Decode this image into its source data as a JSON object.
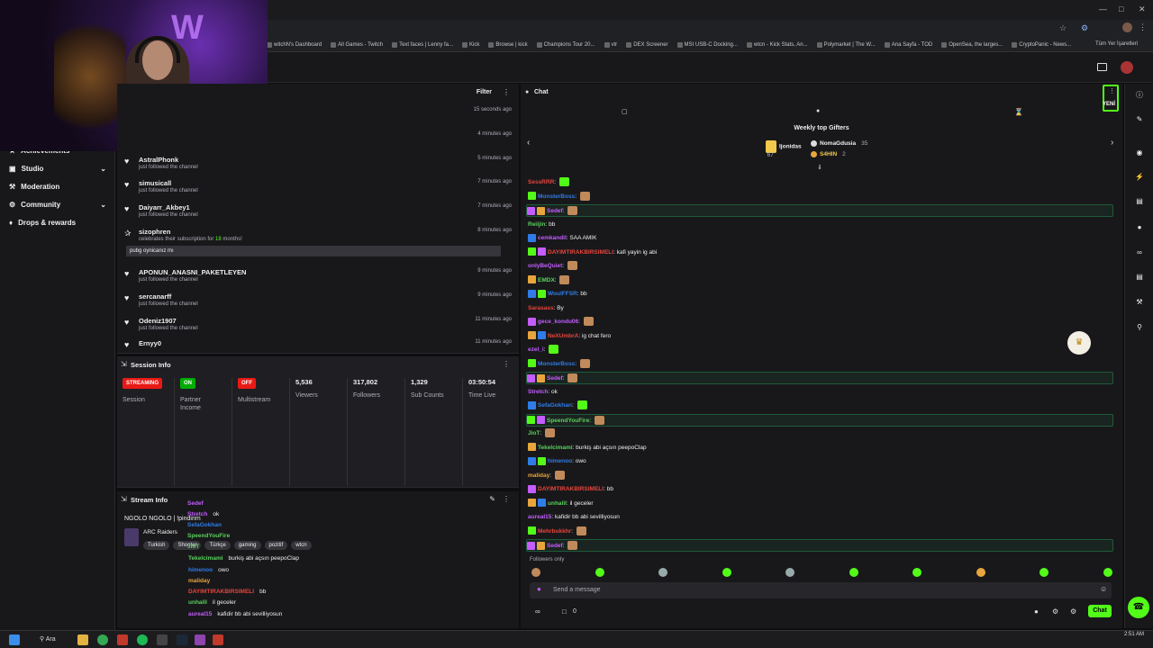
{
  "browser": {
    "bookmarks": [
      "witchN's Dashboard",
      "All Games - Twitch",
      "Text faces | Lenny fa...",
      "Kick",
      "Browse | kick",
      "Champions Tour 20...",
      "vtr",
      "DEX Screener",
      "MSI USB-C Docking...",
      "wtcn - Kick Stats, An...",
      "Polymarket | The W...",
      "Ana Sayfa - TOD",
      "OpenSea, the larges...",
      "CryptoPanic - News..."
    ],
    "bookmarks_folder": "Tüm Yer İşaretleri"
  },
  "nav": {
    "items": [
      {
        "label": "Achievements"
      },
      {
        "label": "Studio"
      },
      {
        "label": "Moderation"
      },
      {
        "label": "Community"
      },
      {
        "label": "Drops & rewards"
      }
    ]
  },
  "activity": {
    "filter_label": "Filter",
    "rows": [
      {
        "user": "",
        "sub": "",
        "time": "15 seconds ago"
      },
      {
        "user": "",
        "sub": "",
        "time": "4 minutes ago"
      },
      {
        "user": "AstralPhonk",
        "sub": "just followed the channel",
        "time": "5 minutes ago"
      },
      {
        "user": "simusicall",
        "sub": "just followed the channel",
        "time": "7 minutes ago"
      },
      {
        "user": "Daiyarr_Akbey1",
        "sub": "just followed the channel",
        "time": "7 minutes ago"
      },
      {
        "user": "sizophren",
        "sub_prefix": "celebrates their subscription for ",
        "sub_months": "18",
        "sub_suffix": " months!",
        "message": "pubg oynicanız mı",
        "time": "8 minutes ago"
      },
      {
        "user": "APONUN_ANASNI_PAKETLEYEN",
        "sub": "just followed the channel",
        "time": "9 minutes ago"
      },
      {
        "user": "sercanarff",
        "sub": "just followed the channel",
        "time": "9 minutes ago"
      },
      {
        "user": "Odeniz1907",
        "sub": "just followed the channel",
        "time": "11 minutes ago"
      },
      {
        "user": "Ernyy0",
        "sub": "",
        "time": "11 minutes ago"
      }
    ]
  },
  "session": {
    "title": "Session Info",
    "streaming": {
      "pill": "STREAMING",
      "label": "Session"
    },
    "partner": {
      "pill": "ON",
      "label": "Partner Income"
    },
    "multistream": {
      "pill": "OFF",
      "label": "Multistream"
    },
    "viewers": {
      "value": "5,536",
      "label": "Viewers"
    },
    "followers": {
      "value": "317,802",
      "label": "Followers"
    },
    "subs": {
      "value": "1,329",
      "label": "Sub Counts"
    },
    "time": {
      "value": "03:50:54",
      "label": "Time Live"
    }
  },
  "stream_info": {
    "title": "Stream Info",
    "stream_title": "NGOLO NGOLO | !pindirim",
    "category": "ARC Raiders",
    "tags": [
      "Turkish",
      "Shooter",
      "Türkçe",
      "gaming",
      "pozitif",
      "wtcn"
    ],
    "overlay": [
      {
        "user": "Sedef",
        "text": ""
      },
      {
        "user": "Stretch",
        "text": "ok"
      },
      {
        "user": "SefaGokhan",
        "text": ""
      },
      {
        "user": "SpeendYouFire",
        "text": ""
      },
      {
        "user": "JioT",
        "text": ""
      },
      {
        "user": "Tekelcimami",
        "text": "burkiş abi açsın peepoClap"
      },
      {
        "user": "himenoo",
        "text": "owo"
      },
      {
        "user": "maliday",
        "text": ""
      },
      {
        "user": "DAYIMTIRAKBIRSIMELI",
        "text": "bb"
      },
      {
        "user": "unhalil",
        "text": "il geceler"
      },
      {
        "user": "aureal15",
        "text": "kafidir bb abi sevilliyosun"
      }
    ]
  },
  "chat": {
    "title": "Chat",
    "new_label": "YENİ",
    "gifters_title": "Weekly top Gifters",
    "gifters": [
      {
        "name": "ljonidas",
        "count": "67"
      },
      {
        "name": "NomaGdusia",
        "count": "35"
      },
      {
        "name": "S4HIN",
        "count": "2"
      }
    ],
    "followers_only": "Followers only",
    "input_placeholder": "Send a message",
    "viewer_count": "0",
    "chat_button": "Chat",
    "messages": [
      {
        "user": "SessRRR",
        "color": "#e8453c",
        "text": "",
        "hl": false
      },
      {
        "user": "MonsterBoss",
        "color": "#2f7ce8",
        "text": "",
        "hl": false
      },
      {
        "user": "Sedef",
        "color": "#c45cff",
        "text": "",
        "hl": true
      },
      {
        "user": "Reiijin",
        "color": "#5ad25a",
        "text": "bb",
        "hl": false
      },
      {
        "user": "cemkandil",
        "color": "#c45cff",
        "text": "SAA AMIK",
        "hl": false
      },
      {
        "user": "DAYIMTIRAKBIRSIMELI",
        "color": "#e8453c",
        "text": "kafi yayin ig abi",
        "hl": false
      },
      {
        "user": "onlyBeQuiet",
        "color": "#c45cff",
        "text": "",
        "hl": false
      },
      {
        "user": "EMDX",
        "color": "#5ad25a",
        "text": "",
        "hl": false
      },
      {
        "user": "WoulFFSR",
        "color": "#2f7ce8",
        "text": "bb",
        "hl": false
      },
      {
        "user": "Sarasass",
        "color": "#e8453c",
        "text": "By",
        "hl": false
      },
      {
        "user": "gece_kondu06",
        "color": "#c45cff",
        "text": "",
        "hl": false
      },
      {
        "user": "NeXUmbrA",
        "color": "#e8453c",
        "text": "ig chat fero",
        "hl": false
      },
      {
        "user": "ezel_i",
        "color": "#c45cff",
        "text": "",
        "hl": false
      },
      {
        "user": "MonsterBoss",
        "color": "#2f7ce8",
        "text": "",
        "hl": false
      },
      {
        "user": "Sedef",
        "color": "#c45cff",
        "text": "",
        "hl": true
      },
      {
        "user": "Stretch",
        "color": "#c45cff",
        "text": "ok",
        "hl": false
      },
      {
        "user": "SefaGokhan",
        "color": "#2f7ce8",
        "text": "",
        "hl": false
      },
      {
        "user": "SpeendYouFire",
        "color": "#5ad25a",
        "text": "",
        "hl": true
      },
      {
        "user": "JioT",
        "color": "#5ad25a",
        "text": "",
        "hl": false
      },
      {
        "user": "Tekelcimami",
        "color": "#5ad25a",
        "text": "burkiş abi açsın peepoClap",
        "hl": false
      },
      {
        "user": "himenoo",
        "color": "#2f7ce8",
        "text": "owo",
        "hl": false
      },
      {
        "user": "maliday",
        "color": "#e8a53c",
        "text": "",
        "hl": false
      },
      {
        "user": "DAYIMTIRAKBIRSIMELI",
        "color": "#e8453c",
        "text": "bb",
        "hl": false
      },
      {
        "user": "unhalil",
        "color": "#5ad25a",
        "text": "il geceler",
        "hl": false
      },
      {
        "user": "aureal15",
        "color": "#c45cff",
        "text": "kafidir bb abi sevilliyosun",
        "hl": false
      },
      {
        "user": "Mehrbukkhr",
        "color": "#e8453c",
        "text": "",
        "hl": false
      },
      {
        "user": "Sedef",
        "color": "#c45cff",
        "text": "",
        "hl": true
      }
    ]
  },
  "taskbar": {
    "search_label": "Ara",
    "time": "2:51 AM"
  }
}
